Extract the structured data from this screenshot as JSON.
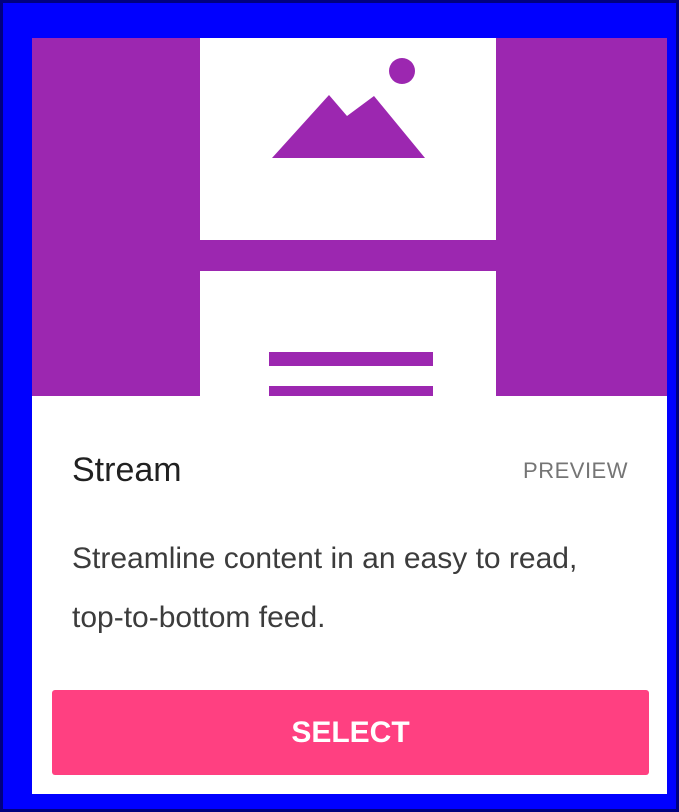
{
  "card": {
    "title": "Stream",
    "preview_label": "PREVIEW",
    "description": "Streamline content in an easy to read, top-to-bottom feed.",
    "select_label": "SELECT",
    "hero_icon": "image-placeholder-icon",
    "feed_icon": "text-lines-icon"
  },
  "colors": {
    "page_border": "#0000ff",
    "hero_background": "#9c27b0",
    "panel": "#ffffff",
    "accent_button": "#ff4081"
  }
}
